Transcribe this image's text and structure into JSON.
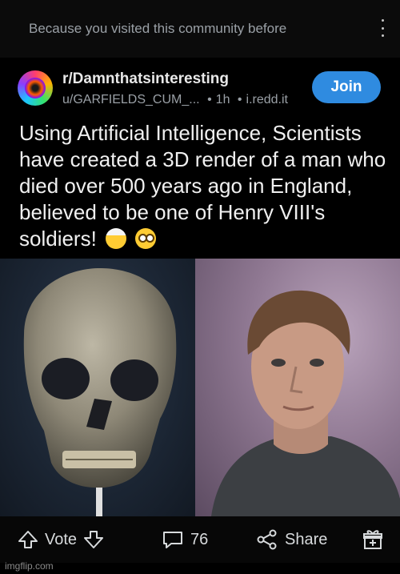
{
  "banner": {
    "reason_text": "Because you visited this community before"
  },
  "post": {
    "subreddit": "r/Damnthatsinteresting",
    "author": "u/GARFIELDS_CUM_...",
    "age": "1h",
    "domain": "i.redd.it",
    "join_label": "Join",
    "title": "Using Artificial Intelligence, Scientists have created a 3D render of a man who died over 500 years ago in England, believed to be one of Henry VIII's soldiers!",
    "title_emojis": [
      "mind-blown-emoji",
      "flushed-emoji"
    ]
  },
  "actions": {
    "vote_label": "Vote",
    "comment_count": "76",
    "share_label": "Share"
  },
  "watermark": "imgflip.com",
  "colors": {
    "join_button": "#2f8be0",
    "background": "#000000"
  }
}
